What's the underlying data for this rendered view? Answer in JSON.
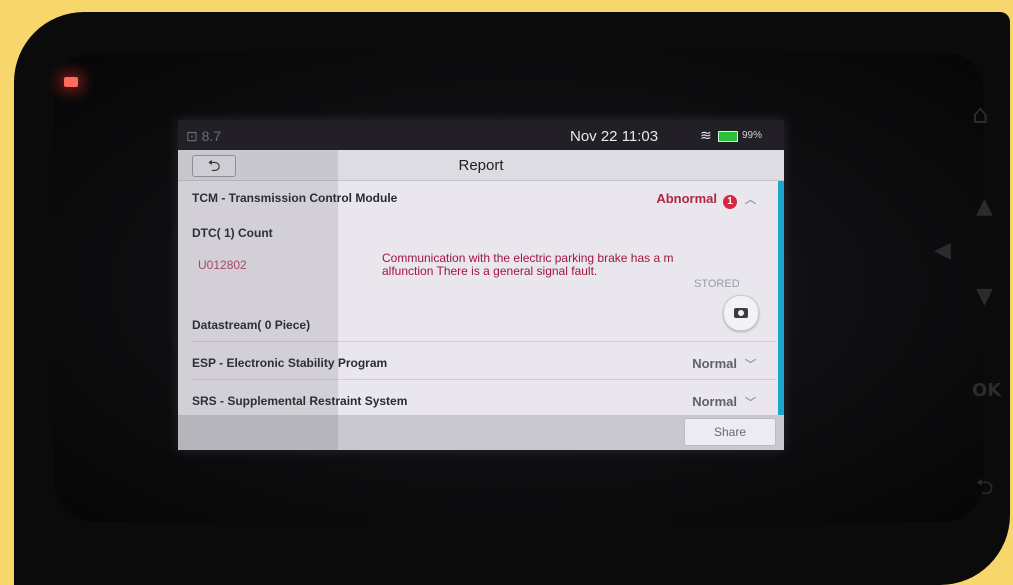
{
  "statusbar": {
    "left_text": "⊡ 8.7",
    "date_time": "Nov 22   11:03",
    "battery": "99%"
  },
  "header": {
    "back_glyph": "⮌",
    "title": "Report"
  },
  "modules": [
    {
      "name": "TCM - Transmission Control Module",
      "status": "Abnormal",
      "fault_count": "1"
    },
    {
      "name": "ESP - Electronic Stability Program",
      "status": "Normal"
    },
    {
      "name": "SRS - Supplemental Restraint System",
      "status": "Normal"
    }
  ],
  "dtc": {
    "count_label": "DTC( 1) Count",
    "code": "U012802",
    "description": "Communication with the electric parking brake has a m alfunction There is a general signal fault.",
    "state": "STORED"
  },
  "datastream_label": "Datastream( 0 Piece)",
  "footer": {
    "share_label": "Share"
  },
  "device": {
    "key_ok": "OK"
  },
  "icons": {
    "back": "back-arrow-icon",
    "expand": "chevron-up-icon",
    "collapse": "chevron-down-icon",
    "camera": "camera-icon",
    "wifi": "wifi-icon",
    "battery": "battery-icon"
  },
  "colors": {
    "accent": "#1aa6cf",
    "abnormal": "#d6283f",
    "frame": "#f7d66c"
  }
}
